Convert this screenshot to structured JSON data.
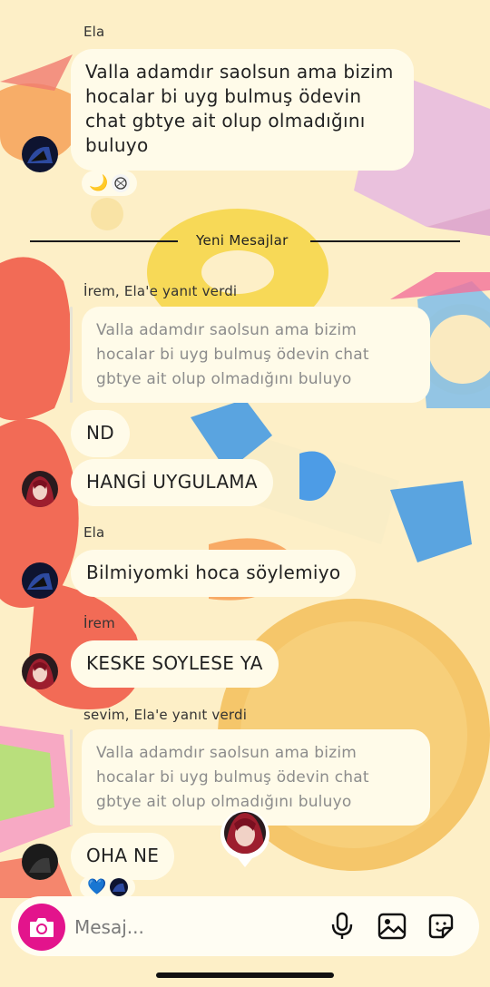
{
  "messages": [
    {
      "sender": "Ela",
      "text_lines": [
        "Valla adamdır saolsun ama bizim",
        "hocalar bi uyg bulmuş ödevin",
        "chat gbtye ait olup olmadığını",
        "buluyo"
      ],
      "reactions": [
        "moon-emoji",
        "white-avatar"
      ]
    },
    {
      "text": "ND"
    },
    {
      "text": "HANGİ UYGULAMA"
    },
    {
      "sender": "Ela",
      "text": "Bilmiyomki hoca söylemiyo"
    },
    {
      "sender": "İrem",
      "text": "KESKE SOYLESE YA"
    },
    {
      "text": "OHA NE",
      "reactions": [
        "blue-heart-emoji",
        "dark-avatar"
      ]
    }
  ],
  "reply_1": {
    "header": "İrem, Ela'e yanıt verdi",
    "quote_lines": [
      "Valla adamdır saolsun ama bizim",
      "hocalar bi uyg bulmuş ödevin chat",
      "gbtye ait olup olmadığını buluyo"
    ]
  },
  "reply_2": {
    "header": "sevim, Ela'e yanıt verdi",
    "quote_lines": [
      "Valla adamdır saolsun ama bizim",
      "hocalar bi uyg bulmuş ödevin chat",
      "gbtye ait olup olmadığını buluyo"
    ]
  },
  "divider": {
    "label": "Yeni Mesajlar"
  },
  "reaction_glyphs": {
    "moon": "🌙",
    "heart": "💙"
  },
  "composer": {
    "placeholder": "Mesaj...",
    "icons": [
      "camera-icon",
      "microphone-icon",
      "gallery-icon",
      "sticker-icon"
    ]
  },
  "colors": {
    "background": "#fdefc7",
    "bubble": "#fffbe9",
    "camera_button": "#e3148c",
    "quote_text": "#8c8c8c"
  }
}
